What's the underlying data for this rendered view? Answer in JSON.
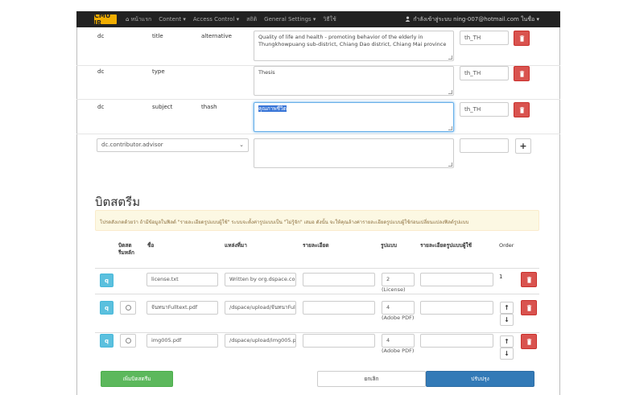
{
  "navbar": {
    "brand": "CMU IR",
    "home": "หน้าแรก",
    "content": "Content ▾",
    "access_control": "Access Control ▾",
    "stats": "สถิติ",
    "general_settings": "General Settings ▾",
    "help": "วิธีใช้",
    "user": "กำลังเข้าสู่ระบบ ning-007@hotmail.com ในชื่อ ▾"
  },
  "metadata": [
    {
      "schema": "dc",
      "element": "title",
      "qualifier": "alternative",
      "value": "Quality of life and health - promoting behavior of the elderly in Thungkhowpuang sub-district, Chiang Dao district, Chiang Mai province",
      "lang": "th_TH"
    },
    {
      "schema": "dc",
      "element": "type",
      "qualifier": "",
      "value": "Thesis",
      "lang": "th_TH"
    },
    {
      "schema": "dc",
      "element": "subject",
      "qualifier": "thash",
      "value": "คุณภาพชีวิต",
      "lang": "th_TH"
    }
  ],
  "new_field": {
    "select_value": "dc.contributor.advisor",
    "value": "",
    "lang": "",
    "add_label": "+"
  },
  "bitstream": {
    "title": "บิตสตรีม",
    "alert": "โปรดสังเกตด้วยว่า ถ้ามีข้อมูลในฟิลด์ \"รายละเอียดรูปแบบผู้ใช้\" ระบบจะตั้งค่ารูปแบบเป็น \"ไม่รู้จัก\" เสมอ ดังนั้น จะให้คุณล้างค่ารายละเอียดรูปแบบผู้ใช้ก่อนเปลี่ยนแปลงฟิลด์รูปแบบ",
    "headers": {
      "primary": "บิตสตรีมหลัก",
      "name": "ชื่อ",
      "source": "แหล่งที่มา",
      "description": "รายละเอียด",
      "format": "รูปแบบ",
      "user_format": "รายละเอียดรูปแบบผู้ใช้",
      "order": "Order"
    },
    "rows": [
      {
        "name": "license.txt",
        "source": "Written by org.dspace.cor",
        "description": "",
        "format_id": "2",
        "format_name": "(License)",
        "user_format": "",
        "order": "1",
        "has_radio": false,
        "has_arrows": false
      },
      {
        "name": "จันทนาFulltext.pdf",
        "source": "/dspace/upload/จันทนาFul",
        "description": "",
        "format_id": "4",
        "format_name": "(Adobe PDF)",
        "user_format": "",
        "order": "",
        "has_radio": true,
        "has_arrows": true
      },
      {
        "name": "img005.pdf",
        "source": "/dspace/upload/img005.p",
        "description": "",
        "format_id": "4",
        "format_name": "(Adobe PDF)",
        "user_format": "",
        "order": "",
        "has_radio": true,
        "has_arrows": true
      }
    ]
  },
  "actions": {
    "add_bitstream": "เพิ่มบิตสตรีม",
    "cancel": "ยกเลิก",
    "update": "ปรับปรุง"
  },
  "colors": {
    "navbar": "#222222",
    "brand": "#f0ad00",
    "danger": "#d9534f",
    "info": "#5bc0de",
    "success": "#5cb85c",
    "primary": "#337ab7"
  }
}
